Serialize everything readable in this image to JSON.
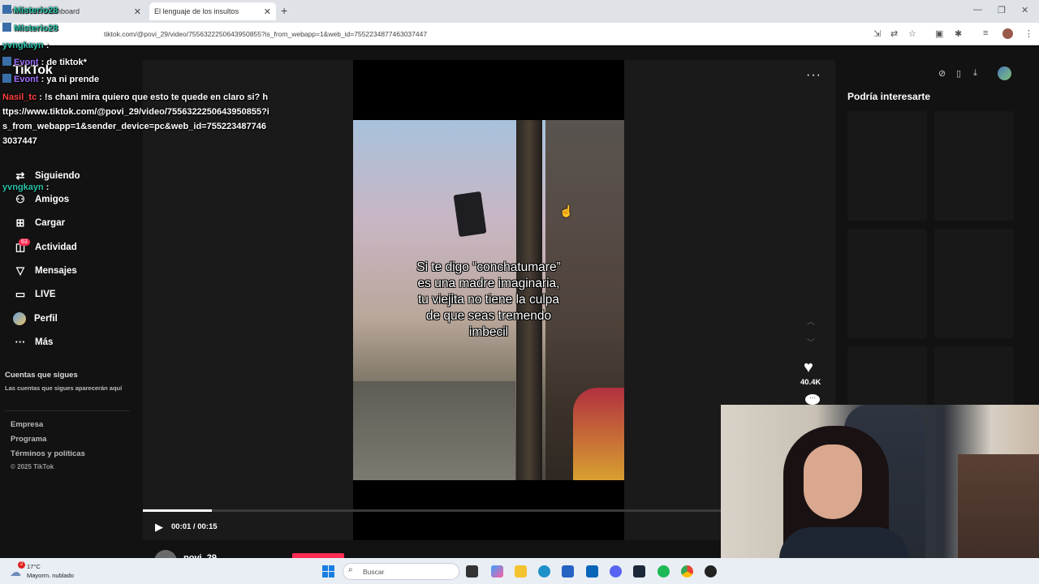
{
  "browser": {
    "tabs": [
      {
        "label": "Misterio28 Dashboard",
        "active": false
      },
      {
        "label": "El lenguaje de los insultos",
        "active": true
      }
    ],
    "url": "tiktok.com/@povi_29/video/7556322250643950855?is_from_webapp=1&web_id=7552234877463037447"
  },
  "tiktok": {
    "logo": "TikTok",
    "nav": [
      {
        "label": "Siguiendo",
        "icon": "following-icon"
      },
      {
        "label": "Amigos",
        "icon": "friends-icon"
      },
      {
        "label": "Cargar",
        "icon": "upload-icon"
      },
      {
        "label": "Actividad",
        "icon": "activity-icon"
      },
      {
        "label": "Mensajes",
        "icon": "messages-icon"
      },
      {
        "label": "LIVE",
        "icon": "live-icon"
      },
      {
        "label": "Perfil",
        "icon": "profile-icon"
      },
      {
        "label": "Más",
        "icon": "more-icon"
      }
    ],
    "activity_badge": "63",
    "following_header": "Cuentas que sigues",
    "following_note": "Las cuentas que sigues aparecerán aquí",
    "footer": [
      "Empresa",
      "Programa",
      "Términos y políticas"
    ],
    "copyright": "© 2025 TikTok",
    "video": {
      "caption": "Si te digo “conchatumare”\nes una madre imaginaria,\ntu viejita no tiene la culpa\nde que seas tremendo\nimbecil",
      "progress": 0.12,
      "time": "00:01 / 00:15",
      "likes": "40.4K",
      "author": "povi_29"
    },
    "recommend_title": "Podría interesarte"
  },
  "chat": {
    "messages": [
      {
        "user": "Misterio28",
        "text": "",
        "color": "#29c2a8"
      },
      {
        "user": "yvngkayn",
        "text": " : ",
        "color": "#29c2a8"
      },
      {
        "user": "Evont",
        "text": " : de tiktok*",
        "color": "#a070ff"
      },
      {
        "user": "Evont",
        "text": " : ya ni prende",
        "color": "#a070ff"
      }
    ],
    "long_user": "Nasil_tc",
    "long_text": " : !s chani mira quiero que esto te quede en claro si? https://www.tiktok.com/@povi_29/video/7556322250643950855?is_from_webapp=1&sender_device=pc&web_id=7552234877463037447",
    "last_user": "yvngkayn",
    "last_text": " : "
  },
  "taskbar": {
    "weather_temp": "17°C",
    "weather_desc": "Mayorm. nublado",
    "weather_badge": "2",
    "search_placeholder": "Buscar"
  }
}
